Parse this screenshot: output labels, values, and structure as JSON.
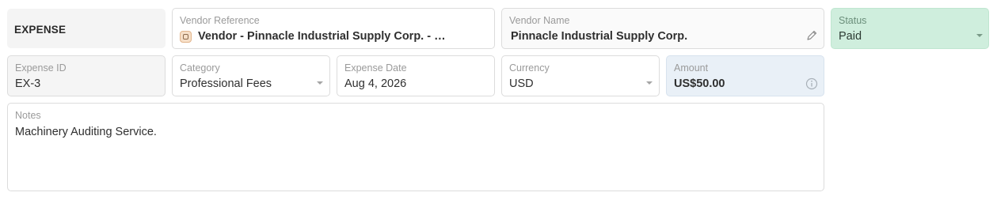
{
  "header": {
    "title": "EXPENSE"
  },
  "fields": {
    "vendor_reference": {
      "label": "Vendor Reference",
      "value": "Vendor - Pinnacle Industrial Supply Corp. - Pr..."
    },
    "vendor_name": {
      "label": "Vendor Name",
      "value": "Pinnacle Industrial Supply Corp."
    },
    "status": {
      "label": "Status",
      "value": "Paid"
    },
    "expense_id": {
      "label": "Expense ID",
      "value": "EX-3"
    },
    "category": {
      "label": "Category",
      "value": "Professional Fees"
    },
    "expense_date": {
      "label": "Expense Date",
      "value": "Aug 4, 2026"
    },
    "currency": {
      "label": "Currency",
      "value": "USD"
    },
    "amount": {
      "label": "Amount",
      "value": "US$50.00"
    },
    "notes": {
      "label": "Notes",
      "value": "Machinery Auditing Service."
    }
  },
  "icons": {
    "vendor": "building-icon",
    "open": "arrow-up-right-icon",
    "edit": "pencil-icon",
    "info": "info-icon",
    "dropdown": "chevron-down-icon"
  },
  "colors": {
    "status_paid_bg": "#cfeedd",
    "amount_bg": "#e9f0f7",
    "vendor_icon_bg": "#f6dfc8"
  }
}
